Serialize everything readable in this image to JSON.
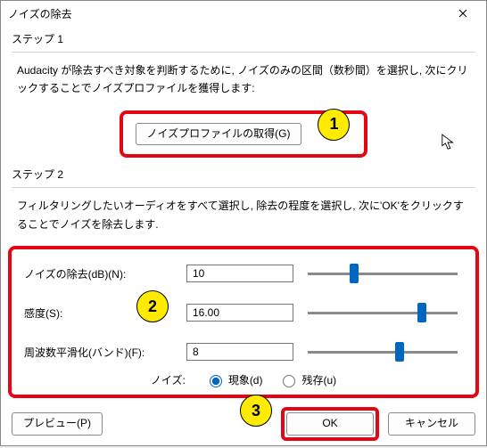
{
  "window": {
    "title": "ノイズの除去"
  },
  "step1": {
    "label": "ステップ 1",
    "desc": "Audacity が除去すべき対象を判断するために, ノイズのみの区間（数秒間）を選択し, 次にクリックすることでノイズプロファイルを獲得します:",
    "profile_button": "ノイズプロファイルの取得(G)"
  },
  "step2": {
    "label": "ステップ 2",
    "desc": "フィルタリングしたいオーディオをすべて選択し, 除去の程度を選択し, 次に'OK'をクリックすることでノイズを除去します.",
    "noise_label": "ノイズの除去(dB)(N):",
    "noise_value": "10",
    "sens_label": "感度(S):",
    "sens_value": "16.00",
    "smooth_label": "周波数平滑化(バンド)(F):",
    "smooth_value": "8",
    "noise_mode_label": "ノイズ:",
    "radio_reduce": "現象(d)",
    "radio_residual": "残存(u)"
  },
  "buttons": {
    "preview": "プレビュー(P)",
    "ok": "OK",
    "cancel": "キャンセル"
  },
  "annotations": {
    "b1": "1",
    "b2": "2",
    "b3": "3"
  }
}
